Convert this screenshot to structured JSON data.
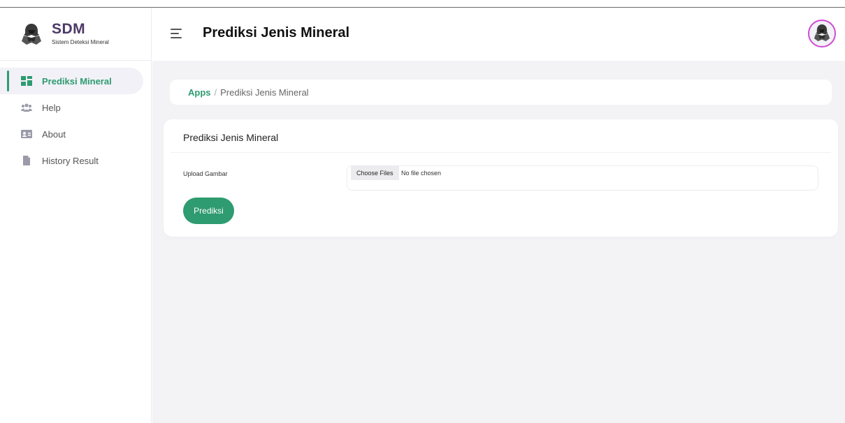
{
  "brand": {
    "name": "SDM",
    "subtitle": "Sistem Deteksi Mineral",
    "logo_icon": "hooded-miner-icon"
  },
  "sidebar": {
    "items": [
      {
        "label": "Prediksi Mineral",
        "icon": "dashboard-grid-icon",
        "active": true
      },
      {
        "label": "Help",
        "icon": "users-group-icon",
        "active": false
      },
      {
        "label": "About",
        "icon": "id-card-icon",
        "active": false
      },
      {
        "label": "History Result",
        "icon": "document-icon",
        "active": false
      }
    ]
  },
  "header": {
    "title": "Prediksi Jenis Mineral",
    "menu_icon": "hamburger-menu-icon",
    "avatar_icon": "hooded-miner-icon"
  },
  "breadcrumb": {
    "root": "Apps",
    "separator": "/",
    "current": "Prediksi Jenis Mineral"
  },
  "form": {
    "title": "Prediksi Jenis Mineral",
    "upload_label": "Upload Gambar",
    "choose_button": "Choose Files",
    "file_status": "No file chosen",
    "submit_label": "Prediksi"
  },
  "colors": {
    "accent": "#2e9b70",
    "brand_text": "#4b3a66",
    "avatar_ring": "#d24ad6",
    "content_bg": "#f3f3f6"
  }
}
